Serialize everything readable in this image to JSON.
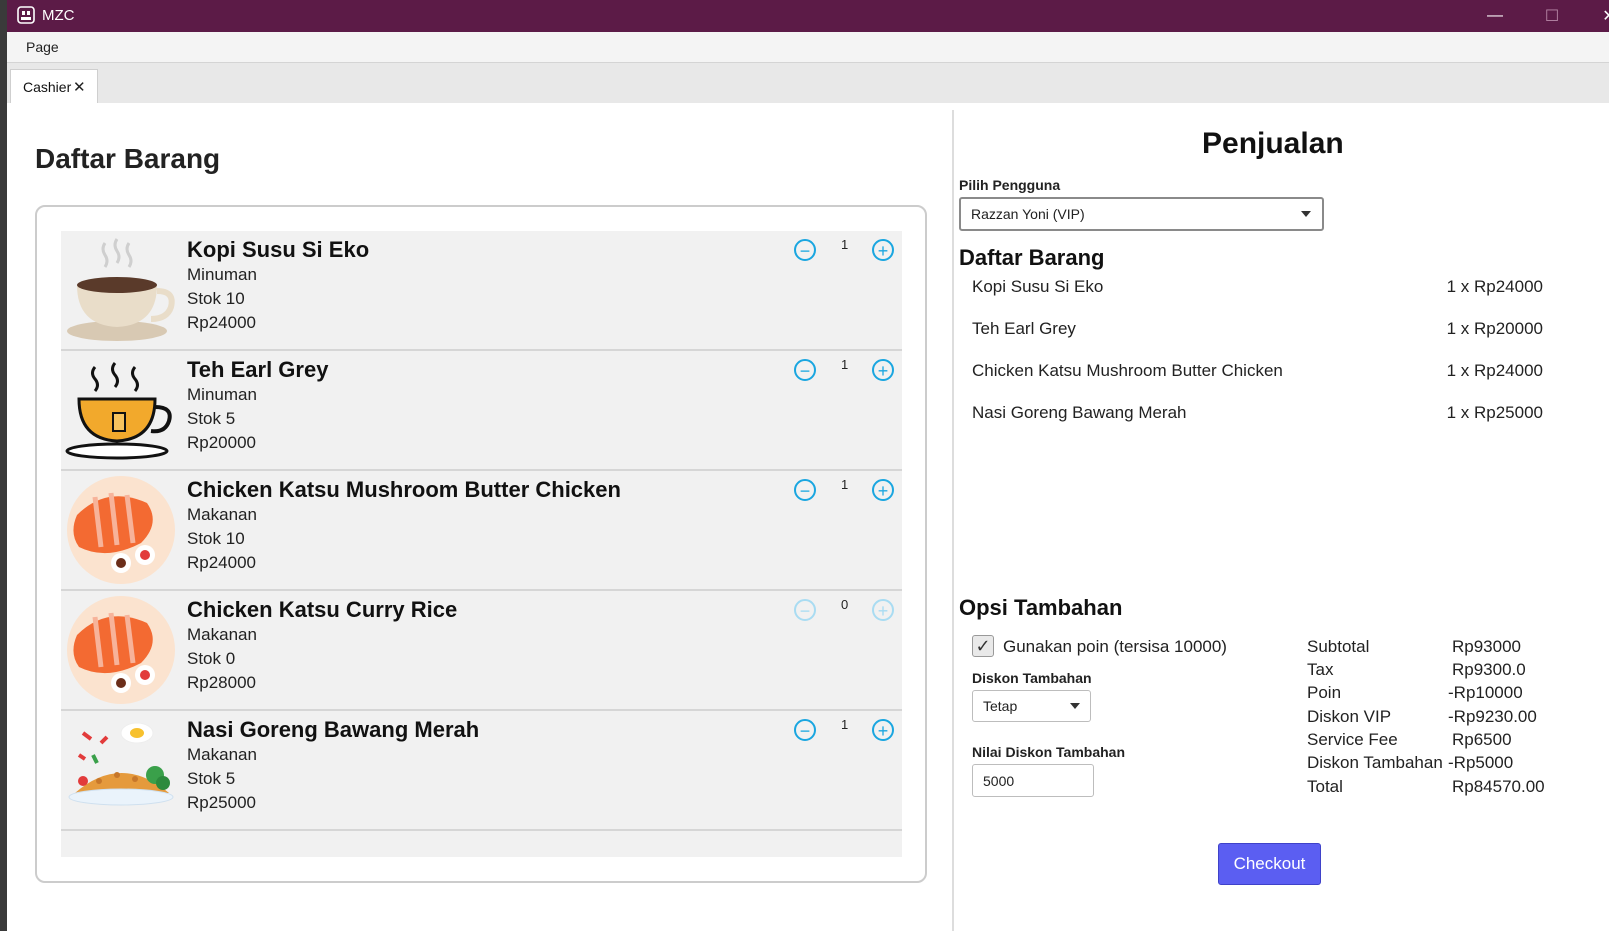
{
  "window": {
    "title": "MZC",
    "icons": {
      "app": "app-icon",
      "minimize": "minimize-icon",
      "maximize": "maximize-icon",
      "close": "close-icon"
    }
  },
  "menu": {
    "items": [
      {
        "label": "Page"
      }
    ]
  },
  "tabs": [
    {
      "label": "Cashier",
      "close_icon": "close-icon"
    }
  ],
  "left": {
    "title": "Daftar Barang",
    "items": [
      {
        "name": "Kopi Susu Si Eko",
        "category": "Minuman",
        "stock": "Stok 10",
        "price": "Rp24000",
        "qty": "1",
        "image": "coffee-cup-icon",
        "enabled": true
      },
      {
        "name": "Teh Earl Grey",
        "category": "Minuman",
        "stock": "Stok 5",
        "price": "Rp20000",
        "qty": "1",
        "image": "tea-cup-icon",
        "enabled": true
      },
      {
        "name": "Chicken Katsu Mushroom Butter Chicken",
        "category": "Makanan",
        "stock": "Stok 10",
        "price": "Rp24000",
        "qty": "1",
        "image": "katsu-plate-icon",
        "enabled": true
      },
      {
        "name": "Chicken Katsu Curry Rice",
        "category": "Makanan",
        "stock": "Stok 0",
        "price": "Rp28000",
        "qty": "0",
        "image": "katsu-plate-icon",
        "enabled": false
      },
      {
        "name": "Nasi Goreng Bawang Merah",
        "category": "Makanan",
        "stock": "Stok 5",
        "price": "Rp25000",
        "qty": "1",
        "image": "fried-rice-icon",
        "enabled": true
      }
    ]
  },
  "right": {
    "title": "Penjualan",
    "user_label": "Pilih Pengguna",
    "user_value": "Razzan Yoni (VIP)",
    "cart_title": "Daftar Barang",
    "cart": [
      {
        "name": "Kopi Susu Si Eko",
        "qty": "1 x Rp24000"
      },
      {
        "name": "Teh Earl Grey",
        "qty": "1 x Rp20000"
      },
      {
        "name": "Chicken Katsu Mushroom Butter Chicken",
        "qty": "1 x Rp24000"
      },
      {
        "name": "Nasi Goreng Bawang Merah",
        "qty": "1 x Rp25000"
      }
    ],
    "options_title": "Opsi Tambahan",
    "use_points_label": "Gunakan poin (tersisa 10000)",
    "use_points_checked": true,
    "discount_type_label": "Diskon Tambahan",
    "discount_type_value": "Tetap",
    "discount_value_label": "Nilai Diskon Tambahan",
    "discount_value": "5000",
    "summary": [
      {
        "label": "Subtotal",
        "value": "Rp93000"
      },
      {
        "label": "Tax",
        "value": "Rp9300.0"
      },
      {
        "label": "Poin",
        "value": "-Rp10000"
      },
      {
        "label": "Diskon VIP",
        "value": "-Rp9230.00"
      },
      {
        "label": "Service Fee",
        "value": "Rp6500"
      },
      {
        "label": "Diskon Tambahan",
        "value": "-Rp5000"
      },
      {
        "label": "Total",
        "value": "Rp84570.00"
      }
    ],
    "checkout_label": "Checkout"
  },
  "colors": {
    "titlebar": "#5c1b47",
    "accent": "#1aa6e0",
    "checkout": "#5b5ef2"
  }
}
